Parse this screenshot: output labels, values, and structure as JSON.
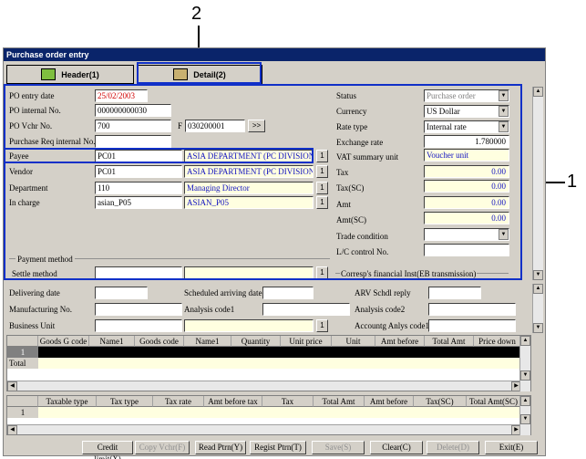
{
  "callouts": {
    "top": "2",
    "right": "1"
  },
  "window": {
    "title": "Purchase order entry"
  },
  "tabs": {
    "header": "Header(1)",
    "detail": "Detail(2)"
  },
  "left_fields": {
    "po_entry_date": {
      "label": "PO entry date",
      "value": "25/02/2003"
    },
    "po_internal_no": {
      "label": "PO internal No.",
      "value": "000000000030"
    },
    "po_vchr_no": {
      "label": "PO Vchr No.",
      "value": "700",
      "f_label": "F",
      "f_value": "030200001",
      "btn": ">>"
    },
    "purchase_req": {
      "label": "Purchase Req internal No.",
      "value": ""
    },
    "payee": {
      "label": "Payee",
      "code": "PC01",
      "name": "ASIA DEPARTMENT (PC DIVISION)"
    },
    "vendor": {
      "label": "Vendor",
      "code": "PC01",
      "name": "ASIA DEPARTMENT (PC DIVISION)"
    },
    "department": {
      "label": "Department",
      "code": "110",
      "name": "Managing Director"
    },
    "in_charge": {
      "label": "In charge",
      "code": "asian_P05",
      "name": "ASIAN_P05"
    },
    "lookup_btn": "1"
  },
  "right_fields": {
    "status": {
      "label": "Status",
      "value": "Purchase order"
    },
    "currency": {
      "label": "Currency",
      "value": "US Dollar"
    },
    "rate_type": {
      "label": "Rate type",
      "value": "Internal rate"
    },
    "exchange_rate": {
      "label": "Exchange rate",
      "value": "1.780000"
    },
    "vat_summary": {
      "label": "VAT summary unit",
      "value": "Voucher unit"
    },
    "tax": {
      "label": "Tax",
      "value": "0.00"
    },
    "tax_sc": {
      "label": "Tax(SC)",
      "value": "0.00"
    },
    "amt": {
      "label": "Amt",
      "value": "0.00"
    },
    "amt_sc": {
      "label": "Amt(SC)",
      "value": "0.00"
    },
    "trade_condition": {
      "label": "Trade condition",
      "value": ""
    },
    "lc_control": {
      "label": "L/C control No.",
      "value": ""
    }
  },
  "payment": {
    "group_label": "Payment method",
    "settle_label": "Settle method",
    "corresp_label": "Corresp's financial Inst(EB transmission)"
  },
  "middle": {
    "delivering_date": "Delivering date",
    "scheduled_arriving": "Scheduled arriving date",
    "arv_schdl_reply": "ARV Schdl reply",
    "manufacturing_no": "Manufacturing No.",
    "analysis_code1": "Analysis code1",
    "analysis_code2": "Analysis code2",
    "business_unit": "Business Unit",
    "accountg_anlys": "Accountg Anlys code1"
  },
  "goods_grid": {
    "headers": [
      "Goods G code",
      "Name1",
      "Goods code",
      "Name1",
      "Quantity",
      "Unit price",
      "Unit",
      "Amt before",
      "Total Amt",
      "Price down"
    ],
    "row1_no": "1",
    "total_label": "Total"
  },
  "tax_grid": {
    "headers": [
      "Taxable type",
      "Tax type",
      "Tax rate",
      "Amt before tax",
      "Tax",
      "Total Amt",
      "Amt before",
      "Tax(SC)",
      "Total Amt(SC)"
    ],
    "row1_no": "1"
  },
  "footer": {
    "credit_limit": "Credit limit(X)",
    "copy_vchr": "Copy Vchr(F)",
    "read_ptrn": "Read Ptrn(Y)",
    "regist_ptrn": "Regist Ptrn(T)",
    "save": "Save(S)",
    "clear": "Clear(C)",
    "delete": "Delete(D)",
    "exit": "Exit(E)"
  }
}
